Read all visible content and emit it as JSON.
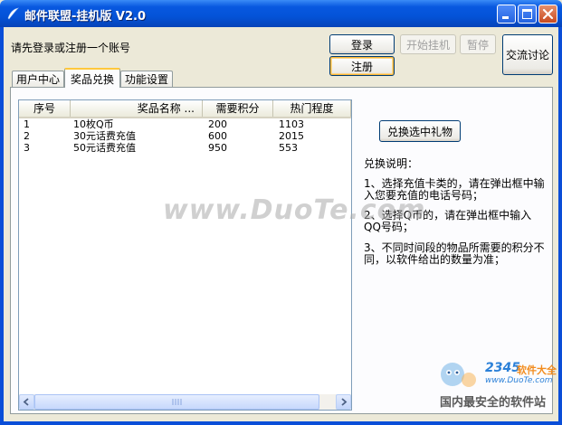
{
  "window": {
    "title": "邮件联盟-挂机版 V2.0",
    "controls": [
      "minimize-icon",
      "maximize-icon",
      "close-icon"
    ]
  },
  "status": {
    "text": "请先登录或注册一个账号"
  },
  "buttons": {
    "login": "登录",
    "register": "注册",
    "start_hangup": "开始挂机",
    "pause": "暂停",
    "discuss": "交流讨论",
    "redeem_selected": "兑换选中礼物"
  },
  "tabs": [
    {
      "label": "用户中心",
      "active": false
    },
    {
      "label": "奖品兑换",
      "active": true
    },
    {
      "label": "功能设置",
      "active": false
    }
  ],
  "list": {
    "columns": [
      "序号",
      "奖品名称 ...",
      "需要积分",
      "热门程度"
    ],
    "rows": [
      [
        "1",
        "10枚Q币",
        "200",
        "1103"
      ],
      [
        "2",
        "30元话费充值",
        "600",
        "2015"
      ],
      [
        "3",
        "50元话费充值",
        "950",
        "553"
      ]
    ]
  },
  "description": {
    "title": "兑换说明：",
    "items": [
      "1、选择充值卡类的，请在弹出框中输入您要充值的电话号码；",
      "2、选择Q币的，请在弹出框中输入QQ号码；",
      "3、不同时间段的物品所需要的积分不同，以软件给出的数量为准；"
    ]
  },
  "watermark": {
    "text": "www.DuoTe.com"
  },
  "logo": {
    "number": "2345",
    "soft": "软件大全",
    "url": "www.DuoTe.com",
    "slogan": "国内最安全的软件站"
  },
  "colors": {
    "titlebar": "#0453D8",
    "window_bg": "#ECE9D8",
    "active_tab_accent": "#FFC83C"
  }
}
